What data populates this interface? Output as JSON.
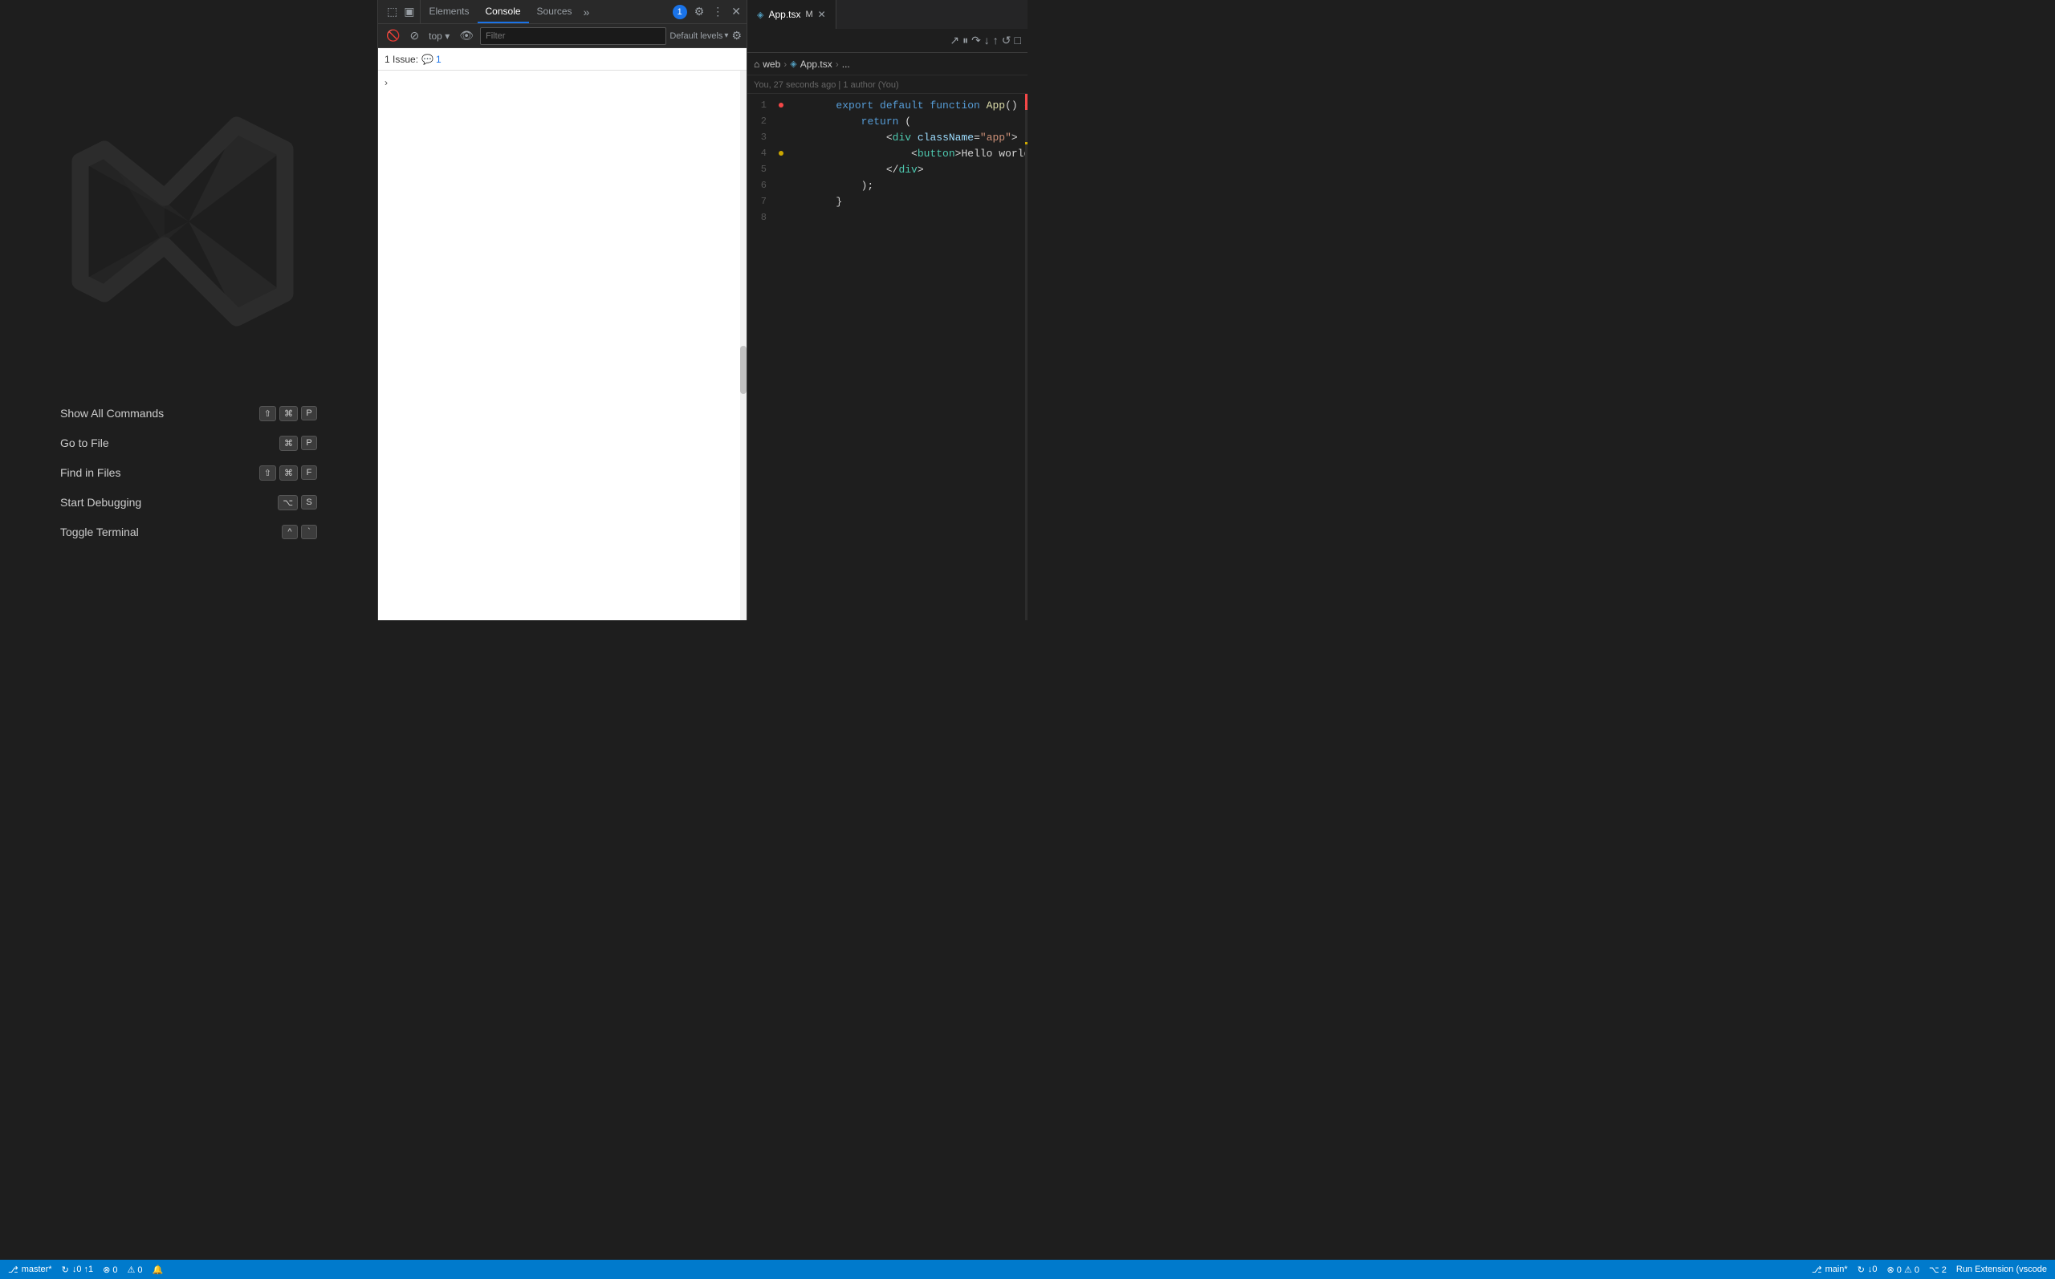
{
  "vscode": {
    "shortcuts": [
      {
        "label": "Show All Commands",
        "keys": [
          "⇧",
          "⌘",
          "P"
        ]
      },
      {
        "label": "Go to File",
        "keys": [
          "⌘",
          "P"
        ]
      },
      {
        "label": "Find in Files",
        "keys": [
          "⇧",
          "⌘",
          "F"
        ]
      },
      {
        "label": "Start Debugging",
        "keys": [
          "⌥",
          "S"
        ]
      },
      {
        "label": "Toggle Terminal",
        "keys": [
          "^",
          "`"
        ]
      }
    ]
  },
  "devtools": {
    "tabs": [
      "Elements",
      "Console",
      "Sources"
    ],
    "active_tab": "Console",
    "more_tabs": "»",
    "toolbar": {
      "top_label": "top",
      "filter_placeholder": "Filter",
      "level_label": "Default levels"
    },
    "issues": {
      "text": "1 Issue:",
      "count": "1"
    }
  },
  "editor": {
    "file_name": "App.tsx",
    "modified": "M",
    "breadcrumb": {
      "root": "web",
      "file": "App.tsx",
      "more": "..."
    },
    "git_info": "You, 27 seconds ago | 1 author (You)",
    "code_lines": [
      {
        "num": 1,
        "text": "export default function App() {",
        "gutter": "error"
      },
      {
        "num": 2,
        "text": "    return (",
        "gutter": ""
      },
      {
        "num": 3,
        "text": "        <div className=\"app\">",
        "gutter": ""
      },
      {
        "num": 4,
        "text": "            <button>Hello world</button>",
        "gutter": "warning"
      },
      {
        "num": 5,
        "text": "        </div>",
        "gutter": ""
      },
      {
        "num": 6,
        "text": "    );",
        "gutter": ""
      },
      {
        "num": 7,
        "text": "}",
        "gutter": ""
      },
      {
        "num": 8,
        "text": "",
        "gutter": ""
      }
    ]
  },
  "statusbar": {
    "left": {
      "branch": "master*",
      "sync": "↓0 ↑1",
      "errors": "⊗ 0",
      "warnings": "⚠ 0"
    },
    "right": {
      "branch": "main*",
      "sync2": "↓0",
      "errors2": "⊗ 0 ⚠ 0",
      "git_graph": "⌥ 2",
      "run_label": "Run Extension (vscode"
    }
  }
}
